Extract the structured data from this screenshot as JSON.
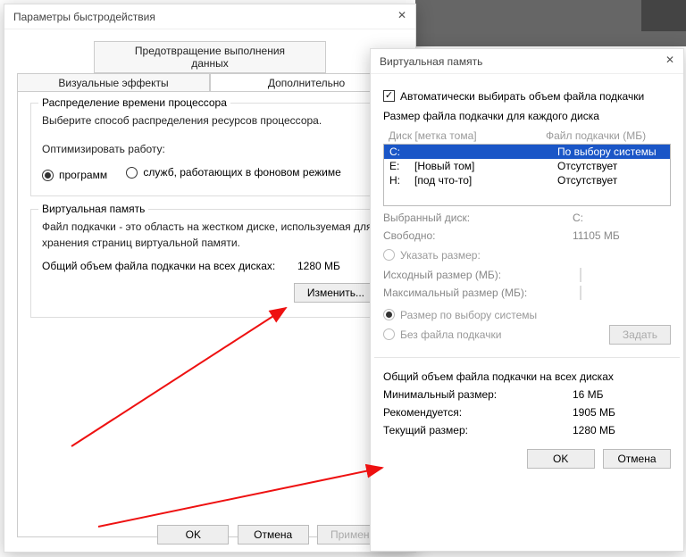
{
  "win1": {
    "title": "Параметры быстродействия",
    "tabDataProtection": "Предотвращение выполнения данных",
    "tabVisual": "Визуальные эффекты",
    "tabAdvanced": "Дополнительно",
    "cpuGroupTitle": "Распределение времени процессора",
    "cpuDesc": "Выберите способ распределения ресурсов процессора.",
    "optimizeLabel": "Оптимизировать работу:",
    "radioPrograms": "программ",
    "radioServices": "служб, работающих в фоновом режиме",
    "vmGroupTitle": "Виртуальная память",
    "vmDesc": "Файл подкачки - это область на жестком диске, используемая для хранения страниц виртуальной памяти.",
    "vmTotalLabel": "Общий объем файла подкачки на всех дисках:",
    "vmTotalValue": "1280 МБ",
    "changeBtn": "Изменить...",
    "ok": "OK",
    "cancel": "Отмена",
    "apply": "Применить"
  },
  "win2": {
    "title": "Виртуальная память",
    "auto": "Автоматически выбирать объем файла подкачки",
    "sizeEach": "Размер файла подкачки для каждого диска",
    "colDrive": "Диск [метка тома]",
    "colFile": "Файл подкачки (МБ)",
    "rows": [
      {
        "d": "C:",
        "l": "",
        "p": "По выбору системы"
      },
      {
        "d": "E:",
        "l": "[Новый том]",
        "p": "Отсутствует"
      },
      {
        "d": "H:",
        "l": "[под что-то]",
        "p": "Отсутствует"
      }
    ],
    "selDriveLabel": "Выбранный диск:",
    "selDriveValue": "C:",
    "freeLabel": "Свободно:",
    "freeValue": "11105 МБ",
    "radioCustom": "Указать размер:",
    "initLabel": "Исходный размер (МБ):",
    "maxLabel": "Максимальный размер (МБ):",
    "radioSystem": "Размер по выбору системы",
    "radioNone": "Без файла подкачки",
    "setBtn": "Задать",
    "totalTitle": "Общий объем файла подкачки на всех дисках",
    "minLabel": "Минимальный размер:",
    "minValue": "16 МБ",
    "recLabel": "Рекомендуется:",
    "recValue": "1905 МБ",
    "curLabel": "Текущий размер:",
    "curValue": "1280 МБ",
    "ok": "OK",
    "cancel": "Отмена"
  }
}
